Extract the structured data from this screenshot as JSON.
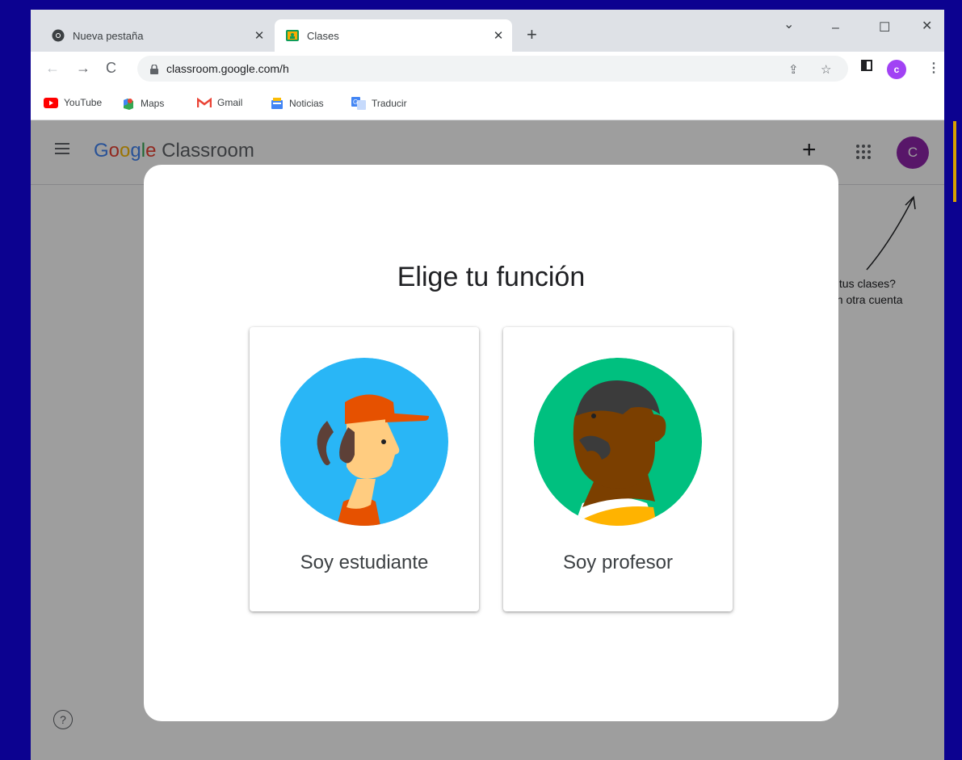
{
  "browser": {
    "tabs": [
      {
        "title": "Nueva pestaña",
        "active": false
      },
      {
        "title": "Clases",
        "active": true
      }
    ],
    "url": "classroom.google.com/h",
    "bookmarks": [
      {
        "label": "YouTube",
        "icon": "youtube-icon"
      },
      {
        "label": "Maps",
        "icon": "maps-icon"
      },
      {
        "label": "Gmail",
        "icon": "gmail-icon"
      },
      {
        "label": "Noticias",
        "icon": "news-icon"
      },
      {
        "label": "Traducir",
        "icon": "translate-icon"
      }
    ],
    "profile_initial": "c"
  },
  "app": {
    "logo_google": "Google",
    "logo_product": "Classroom",
    "avatar_initial": "C",
    "hint_line1": "s tus clases?",
    "hint_line2": "on otra cuenta"
  },
  "modal": {
    "title": "Elige tu función",
    "options": [
      {
        "label": "Soy estudiante"
      },
      {
        "label": "Soy profesor"
      }
    ]
  },
  "colors": {
    "background": "#0c0290",
    "avatar": "#8e24aa",
    "student_bg": "#29b6f6",
    "teacher_bg": "#00c07f"
  }
}
